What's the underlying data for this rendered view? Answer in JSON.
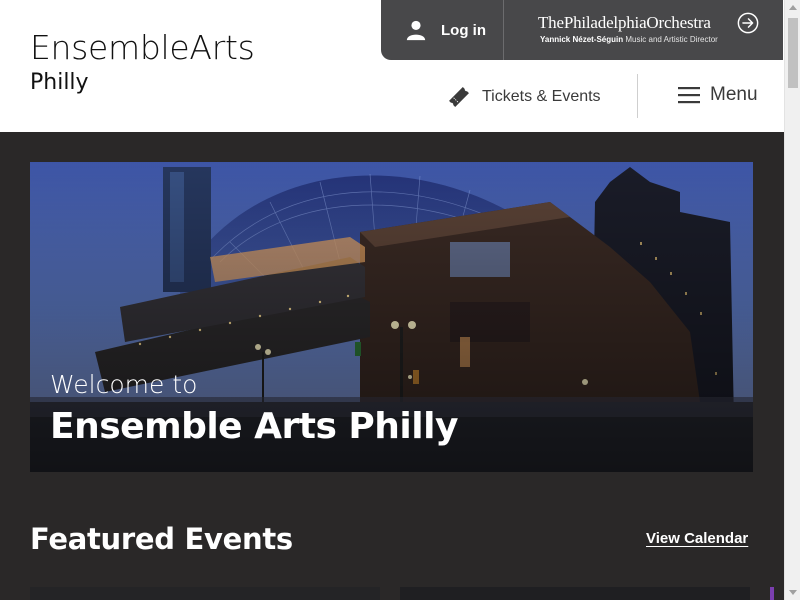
{
  "header": {
    "logo_main": "EnsembleArts",
    "logo_sub": "Philly",
    "login_label": "Log in",
    "orchestra_title": "ThePhiladelphiaOrchestra",
    "orchestra_director_name": "Yannick Nézet-Séguin",
    "orchestra_director_role": "Music and Artistic Director",
    "tickets_label": "Tickets & Events",
    "menu_label": "Menu",
    "icons": [
      "user-icon",
      "arrow-right-circle-icon",
      "ticket-icon",
      "hamburger-menu-icon"
    ]
  },
  "hero": {
    "pre_title": "Welcome to",
    "title": "Ensemble Arts Philly"
  },
  "featured": {
    "title": "Featured Events",
    "view_calendar_label": "View Calendar"
  },
  "colors": {
    "page_background": "#2a2828",
    "top_bar": "#48484a",
    "accent": "#7b3fb0"
  }
}
